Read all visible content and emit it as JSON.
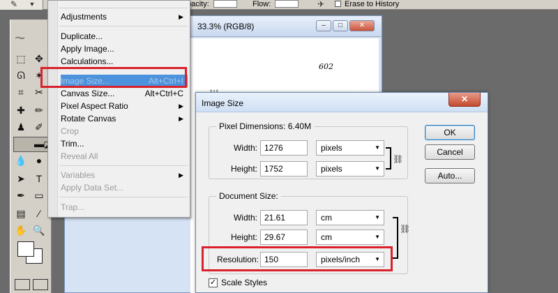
{
  "options_bar": {
    "opacity_label": "pacity:",
    "flow_label": "Flow:",
    "erase_to_history_label": "Erase to History",
    "erase_to_history_checked": false
  },
  "toolbox": {
    "tools": [
      "marquee-tool",
      "move-tool",
      "lasso-tool",
      "magic-wand-tool",
      "crop-tool",
      "slice-tool",
      "healing-brush-tool",
      "brush-tool",
      "clone-stamp-tool",
      "history-brush-tool",
      "eraser-tool",
      "gradient-tool",
      "blur-tool",
      "dodge-tool",
      "path-selection-tool",
      "type-tool",
      "pen-tool",
      "shape-tool",
      "notes-tool",
      "eyedropper-tool",
      "hand-tool",
      "zoom-tool"
    ],
    "selected_tool": "eraser-tool",
    "foreground_color": "#ffffff",
    "background_color": "#ffffff"
  },
  "document": {
    "title": "33.3% (RGB/8)",
    "page_number": "602"
  },
  "image_menu": {
    "items": [
      {
        "label": "Adjustments",
        "submenu": true,
        "disabled": false
      },
      {
        "label": "Duplicate...",
        "disabled": false
      },
      {
        "label": "Apply Image...",
        "disabled": false
      },
      {
        "label": "Calculations...",
        "disabled": false
      },
      {
        "label": "Image Size...",
        "shortcut": "Alt+Ctrl+I",
        "highlighted": true
      },
      {
        "label": "Canvas Size...",
        "shortcut": "Alt+Ctrl+C",
        "disabled": false
      },
      {
        "label": "Pixel Aspect Ratio",
        "submenu": true,
        "disabled": false
      },
      {
        "label": "Rotate Canvas",
        "submenu": true,
        "disabled": false
      },
      {
        "label": "Crop",
        "disabled": true
      },
      {
        "label": "Trim...",
        "disabled": false
      },
      {
        "label": "Reveal All",
        "disabled": true
      },
      {
        "label": "Variables",
        "submenu": true,
        "disabled": true
      },
      {
        "label": "Apply Data Set...",
        "disabled": true
      },
      {
        "label": "Trap...",
        "disabled": true
      }
    ]
  },
  "image_size_dialog": {
    "title": "Image Size",
    "close_glyph": "✕",
    "pixel_dimensions": {
      "label": "Pixel Dimensions:",
      "size": "6.40M",
      "width_label": "Width:",
      "width_value": "1276",
      "width_unit": "pixels",
      "height_label": "Height:",
      "height_value": "1752",
      "height_unit": "pixels"
    },
    "document_size": {
      "label": "Document Size:",
      "width_label": "Width:",
      "width_value": "21.61",
      "width_unit": "cm",
      "height_label": "Height:",
      "height_value": "29.67",
      "height_unit": "cm",
      "resolution_label": "Resolution:",
      "resolution_value": "150",
      "resolution_unit": "pixels/inch"
    },
    "scale_styles_label": "Scale Styles",
    "scale_styles_checked": true,
    "buttons": {
      "ok": "OK",
      "cancel": "Cancel",
      "auto": "Auto..."
    }
  },
  "highlight_color": "#d9212b"
}
